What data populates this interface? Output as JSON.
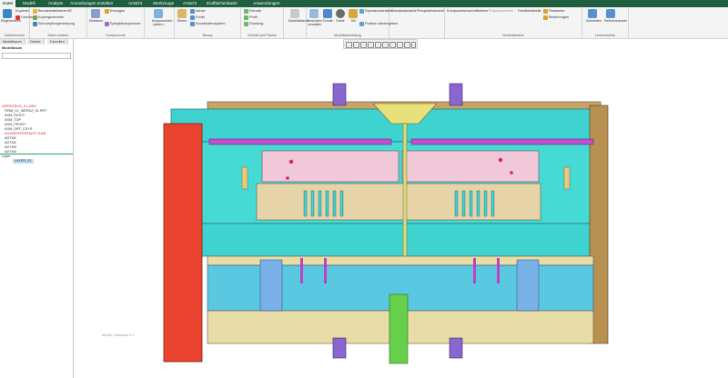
{
  "tabs": [
    "Datei",
    "Modell",
    "Analyse",
    "Anmerkungen erstellen",
    "Ansicht",
    "Werkzeuge",
    "Ansicht",
    "Endflächenbasis",
    "Anwendungen"
  ],
  "ribbon": {
    "groups": [
      {
        "label": "Zeitenformen",
        "items": [
          "Regenerieren",
          "Kopieren",
          "Löschen"
        ]
      },
      {
        "label": "Daten ändern",
        "items": [
          "Benutzerdefinierte KE",
          "Kopiergeometrie",
          "Schrumpfungsmessung"
        ]
      },
      {
        "label": "Komponente",
        "items": [
          "Einbauen",
          "Erzeugen",
          "Spiegelkomponente"
        ]
      },
      {
        "label": "",
        "items": [
          "Komponenten-pattern"
        ]
      },
      {
        "label": "Bezug",
        "items": [
          "Ebene",
          "Achse",
          "Punkt",
          "Koordinatensystem"
        ]
      },
      {
        "label": "Schnitt und Fläche",
        "items": [
          "Extrude",
          "Profil",
          "Rundung"
        ]
      },
      {
        "label": "Modellabsicht",
        "items": [
          "Modellabsicht"
        ]
      },
      {
        "label": "Modelldarstellung",
        "items": [
          "Ansichten verwalten",
          "Schnitt",
          "Farbe",
          "Stil",
          "Explosionsansicht",
          "Position wiedergeben"
        ]
      },
      {
        "label": "",
        "items": [
          "Standardansicht",
          "Perspektivansicht"
        ]
      },
      {
        "label": "Modellabsicht",
        "items": [
          "Komponentenschnittebene",
          "Regelparameter",
          "Familientabelle",
          "Parameter",
          "Beziehungen"
        ]
      },
      {
        "label": "Unterschiede",
        "items": [
          "Schneiden",
          "Referenzviewer"
        ]
      }
    ]
  },
  "left_panel": {
    "tabs": [
      "Modellbaum",
      "Ordner",
      "Favoriten"
    ],
    "title": "Modellbaum",
    "tree": [
      "WERKZEUG_01.ASM",
      "FIRM_01_WERKZ_01.PRT",
      "ASM_RIGHT",
      "ASM_TOP",
      "ASM_FRONT",
      "ASM_DEF_CSYS",
      "AUSWERFERPAKET.ASM",
      "ADTM1",
      "ADTM2",
      "ADTM3",
      "ADTM4"
    ],
    "layers_label": "Layer",
    "layers_item": "LAYER_01"
  },
  "status": "Model: Selected 0 0"
}
